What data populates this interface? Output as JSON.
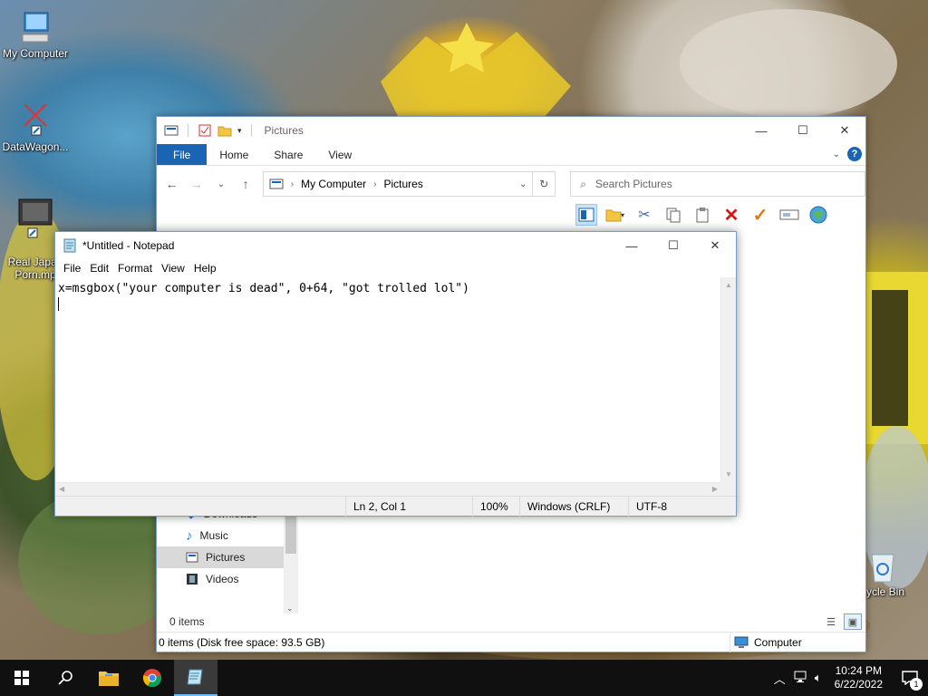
{
  "desktop": {
    "icons": [
      {
        "label": "My Computer",
        "icon": "computer-icon"
      },
      {
        "label": "DataWagon...",
        "icon": "shortcut-icon"
      },
      {
        "label": "Real Japan\nPorn.mp",
        "icon": "video-file-icon"
      },
      {
        "label": "cycle Bin",
        "icon": "recycle-bin-icon"
      }
    ]
  },
  "explorer": {
    "title": "Pictures",
    "tabs": [
      "File",
      "Home",
      "Share",
      "View"
    ],
    "address": {
      "root": "My Computer",
      "current": "Pictures"
    },
    "search_placeholder": "Search Pictures",
    "nav_items": [
      {
        "label": "Downloads",
        "icon": "download-arrow-icon",
        "selected": false
      },
      {
        "label": "Music",
        "icon": "music-note-icon",
        "selected": false
      },
      {
        "label": "Pictures",
        "icon": "pictures-folder-icon",
        "selected": true
      },
      {
        "label": "Videos",
        "icon": "film-icon",
        "selected": false
      }
    ],
    "items_count": "0 items",
    "status_left": "0 items (Disk free space: 93.5 GB)",
    "status_right": "Computer"
  },
  "notepad": {
    "title": "*Untitled - Notepad",
    "menu": [
      "File",
      "Edit",
      "Format",
      "View",
      "Help"
    ],
    "content_line1": "x=msgbox(\"your computer is dead\", 0+64, \"got trolled lol\")",
    "status": {
      "position": "Ln 2, Col 1",
      "zoom": "100%",
      "line_ending": "Windows (CRLF)",
      "encoding": "UTF-8"
    }
  },
  "taskbar": {
    "time": "10:24 PM",
    "date": "6/22/2022",
    "notification_count": "1"
  },
  "colors": {
    "accent": "#1a64b4",
    "taskbar": "#101010",
    "selected_nav": "#d9d9d9"
  }
}
